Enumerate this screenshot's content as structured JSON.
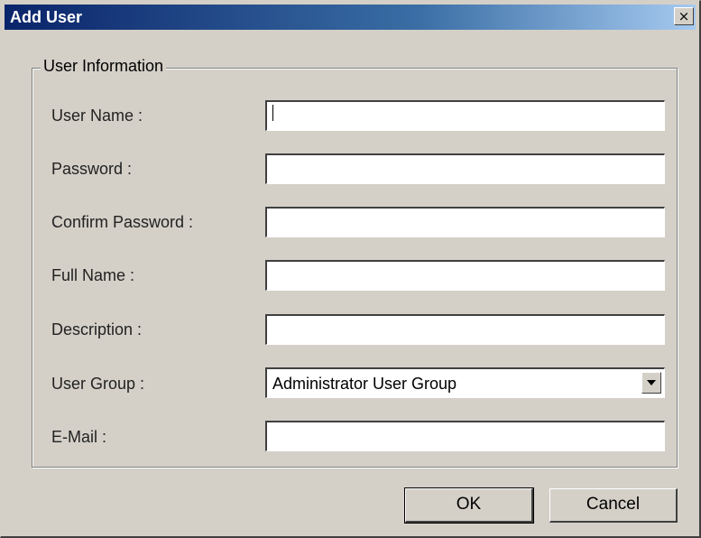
{
  "window": {
    "title": "Add User",
    "close_symbol": "×"
  },
  "group": {
    "legend": "User Information"
  },
  "fields": [
    {
      "label": "User Name :",
      "value": ""
    },
    {
      "label": "Password :",
      "value": ""
    },
    {
      "label": "Confirm Password :",
      "value": ""
    },
    {
      "label": "Full Name :",
      "value": ""
    },
    {
      "label": "Description :",
      "value": ""
    },
    {
      "label": "User Group :",
      "value": "Administrator User Group"
    },
    {
      "label": "E-Mail :",
      "value": ""
    }
  ],
  "buttons": {
    "ok": "OK",
    "cancel": "Cancel"
  },
  "colors": {
    "face": "#d4d0c8",
    "title_start": "#0a246a",
    "title_end": "#a6caf0"
  },
  "icons": {
    "close": "close-icon",
    "dropdown": "chevron-down-icon"
  }
}
